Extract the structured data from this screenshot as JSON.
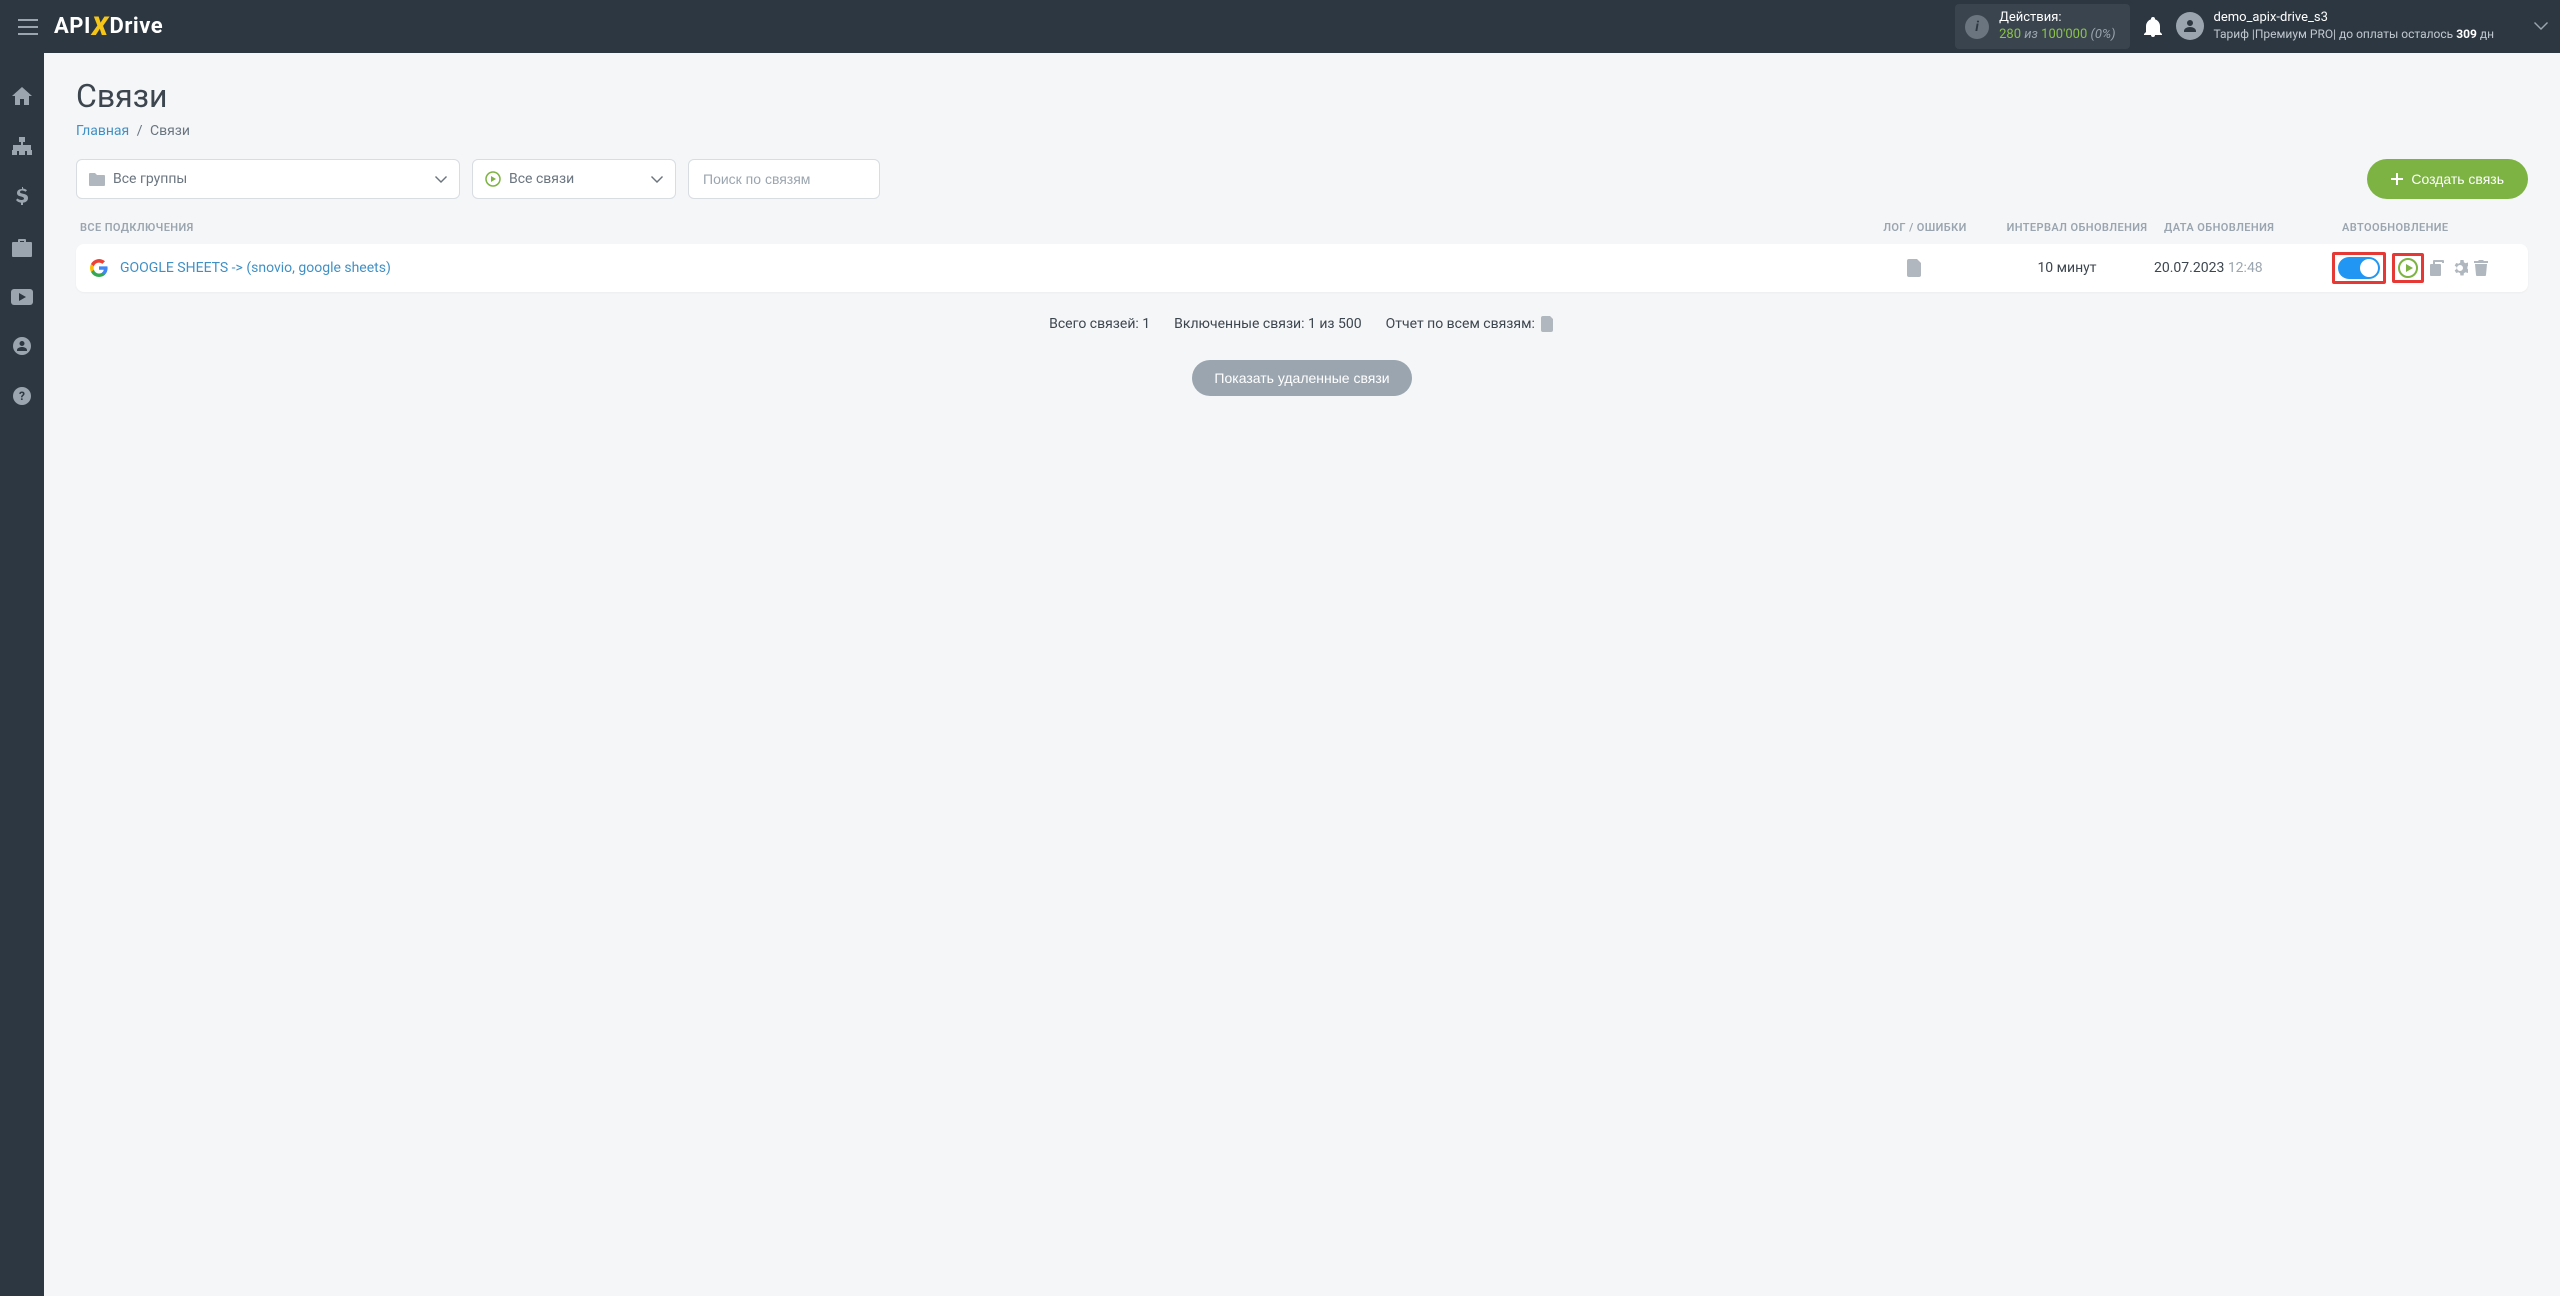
{
  "header": {
    "logo_part1": "API",
    "logo_part2": "Drive",
    "actions_label": "Действия:",
    "actions_used": "280",
    "actions_of": "из",
    "actions_total": "100'000",
    "actions_pct": "(0%)",
    "username": "demo_apix-drive_s3",
    "tariff_prefix": "Тариф |",
    "tariff_name": "Премиум PRO",
    "tariff_mid": "| до оплаты осталось",
    "tariff_days": "309",
    "tariff_suffix": "дн"
  },
  "page": {
    "title": "Связи",
    "breadcrumb_home": "Главная",
    "breadcrumb_sep": "/",
    "breadcrumb_current": "Связи"
  },
  "filters": {
    "groups": "Все группы",
    "connections": "Все связи",
    "search_placeholder": "Поиск по связям",
    "create_btn": "Создать связь"
  },
  "table": {
    "headers": {
      "all": "ВСЕ ПОДКЛЮЧЕНИЯ",
      "log": "ЛОГ / ОШИБКИ",
      "interval": "ИНТЕРВАЛ ОБНОВЛЕНИЯ",
      "date": "ДАТА ОБНОВЛЕНИЯ",
      "auto": "АВТООБНОВЛЕНИЕ"
    },
    "row": {
      "name": "GOOGLE SHEETS -> (snovio, google sheets)",
      "interval": "10 минут",
      "date": "20.07.2023",
      "time": "12:48"
    }
  },
  "summary": {
    "total": "Всего связей: 1",
    "enabled": "Включенные связи: 1 из 500",
    "report": "Отчет по всем связям:"
  },
  "show_deleted": "Показать удаленные связи"
}
